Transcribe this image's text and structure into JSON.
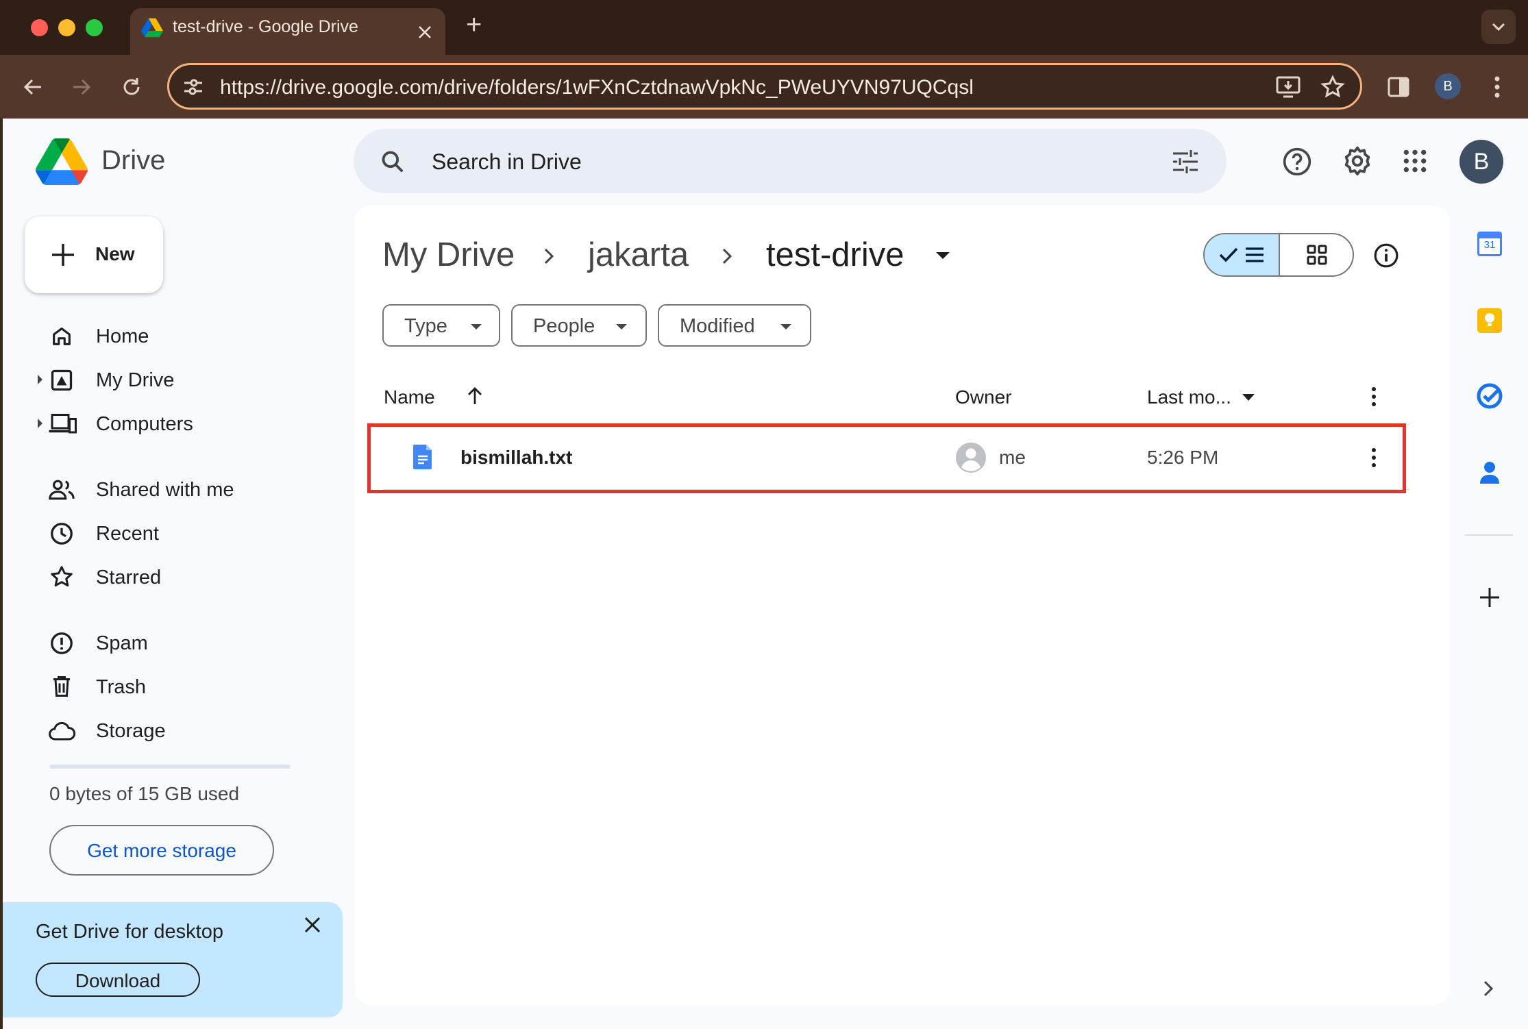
{
  "browser": {
    "tab_title": "test-drive - Google Drive",
    "new_tab": "+",
    "url": "https://drive.google.com/drive/folders/1wFXnCztdnawVpkNc_PWeUYVN97UQCqsl",
    "profile_initial": "B"
  },
  "drive": {
    "app_name": "Drive",
    "search_placeholder": "Search in Drive",
    "account_initial": "B",
    "new_button": "New",
    "nav": [
      {
        "label": "Home"
      },
      {
        "label": "My Drive"
      },
      {
        "label": "Computers"
      },
      {
        "label": "Shared with me"
      },
      {
        "label": "Recent"
      },
      {
        "label": "Starred"
      },
      {
        "label": "Spam"
      },
      {
        "label": "Trash"
      },
      {
        "label": "Storage"
      }
    ],
    "storage": {
      "used_text": "0 bytes of 15 GB used",
      "used_fraction": 0.0,
      "cta": "Get more storage"
    },
    "promo": {
      "title": "Get Drive for desktop",
      "button": "Download"
    },
    "breadcrumb": [
      "My Drive",
      "jakarta",
      "test-drive"
    ],
    "filters": [
      "Type",
      "People",
      "Modified"
    ],
    "columns": {
      "name": "Name",
      "owner": "Owner",
      "modified": "Last mo..."
    },
    "files": [
      {
        "name": "bismillah.txt",
        "owner": "me",
        "modified": "5:26 PM"
      }
    ],
    "side_panel": {
      "calendar_day": "31"
    },
    "colors": {
      "accent": "#0b57d0",
      "highlight": "#e0322e",
      "selected_view": "#c2e7ff"
    }
  }
}
